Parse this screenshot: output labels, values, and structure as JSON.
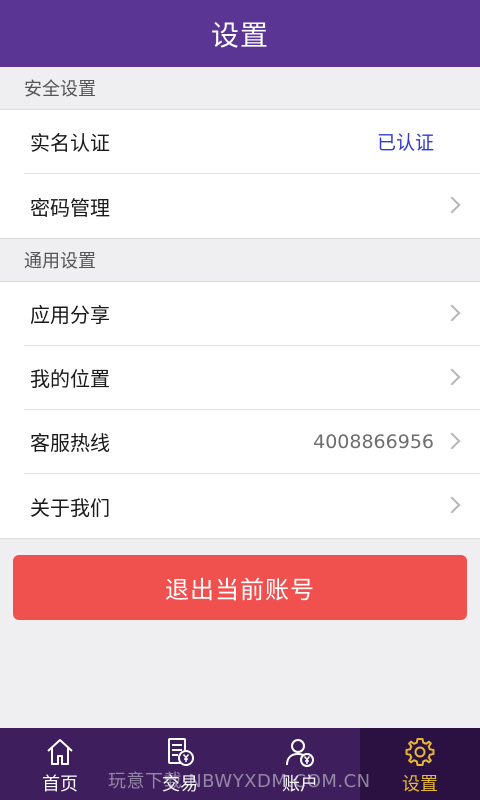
{
  "header": {
    "title": "设置"
  },
  "sections": {
    "security": {
      "title": "安全设置",
      "real_name": {
        "label": "实名认证",
        "value": "已认证"
      },
      "password": {
        "label": "密码管理"
      }
    },
    "general": {
      "title": "通用设置",
      "share": {
        "label": "应用分享"
      },
      "location": {
        "label": "我的位置"
      },
      "hotline": {
        "label": "客服热线",
        "value": "4008866956"
      },
      "about": {
        "label": "关于我们"
      }
    }
  },
  "logout": {
    "label": "退出当前账号"
  },
  "tabbar": {
    "items": [
      {
        "label": "首页",
        "icon": "home-icon"
      },
      {
        "label": "交易",
        "icon": "trade-icon"
      },
      {
        "label": "账户",
        "icon": "account-icon"
      },
      {
        "label": "设置",
        "icon": "gear-icon"
      }
    ]
  },
  "watermark": "玩意下载 NBWYXDM.COM.CN",
  "colors": {
    "header": "#5b3593",
    "tabbar": "#3e1e5c",
    "active_tab": "#e6b83a",
    "logout": "#f0504e",
    "verified": "#2f39d6"
  }
}
